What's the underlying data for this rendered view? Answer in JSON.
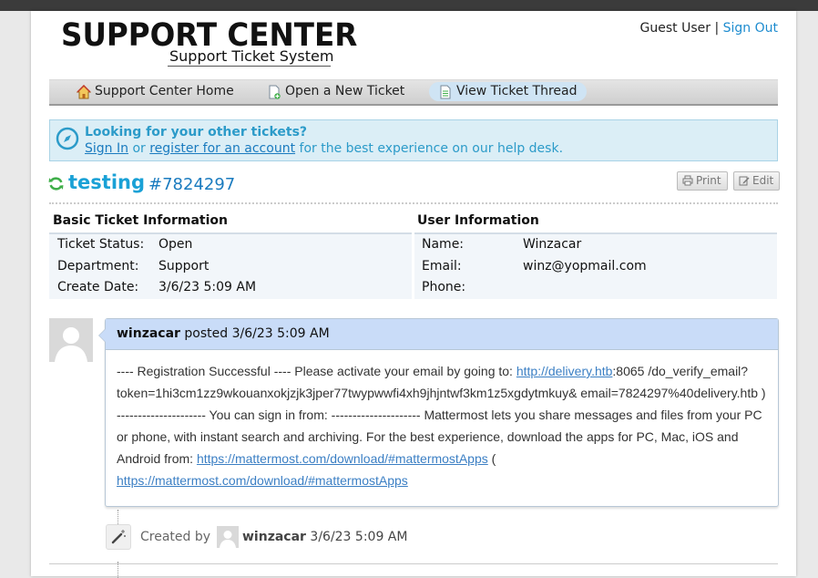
{
  "header": {
    "logo_title": "SUPPORT CENTER",
    "logo_subtitle": "Support Ticket System",
    "user_label": "Guest User",
    "separator": "|",
    "sign_out": "Sign Out"
  },
  "nav": {
    "items": [
      {
        "label": "Support Center Home",
        "icon": "home-icon"
      },
      {
        "label": "Open a New Ticket",
        "icon": "new-ticket-icon"
      },
      {
        "label": "View Ticket Thread",
        "icon": "ticket-thread-icon"
      }
    ]
  },
  "banner": {
    "title": "Looking for your other tickets?",
    "sign_in": "Sign In",
    "or": "or",
    "register": "register for an account",
    "tail": "for the best experience on our help desk."
  },
  "ticket": {
    "subject": "testing",
    "number": "#7824297",
    "print_label": "Print",
    "edit_label": "Edit"
  },
  "basic_info": {
    "heading": "Basic Ticket Information",
    "rows": [
      {
        "label": "Ticket Status:",
        "value": "Open"
      },
      {
        "label": "Department:",
        "value": "Support"
      },
      {
        "label": "Create Date:",
        "value": "3/6/23 5:09 AM"
      }
    ]
  },
  "user_info": {
    "heading": "User Information",
    "rows": [
      {
        "label": "Name:",
        "value": "Winzacar"
      },
      {
        "label": "Email:",
        "value": "winz@yopmail.com"
      },
      {
        "label": "Phone:",
        "value": ""
      }
    ]
  },
  "thread": {
    "author": "winzacar",
    "posted_word": "posted",
    "posted_date": "3/6/23 5:09 AM",
    "body_1": "---- Registration Successful ---- Please activate your email by going to: ",
    "link_1": "http://delivery.htb",
    "body_2": ":8065 /do_verify_email?token=1hi3cm1zz9wkouanxokjzjk3jper77twypwwfi4xh9jhjntwf3km1z5xgdytmkuy& email=7824297%40delivery.htb ) --------------------- You can sign in from: --------------------- Mattermost lets you share messages and files from your PC or phone, with instant search and archiving. For the best experience, download the apps for PC, Mac, iOS and Android from: ",
    "link_2": "https://mattermost.com/download/#mattermostApps",
    "body_3": " ( ",
    "link_3": "https://mattermost.com/download/#mattermostApps"
  },
  "event": {
    "created_by": "Created by",
    "user": "winzacar",
    "date": "3/6/23 5:09 AM"
  },
  "colors": {
    "accent": "#1aa1d6",
    "link": "#1e8ccf",
    "banner_bg": "#dbeef6",
    "post_header_bg": "#c9dcf8",
    "refresh_icon": "#3fae49"
  }
}
